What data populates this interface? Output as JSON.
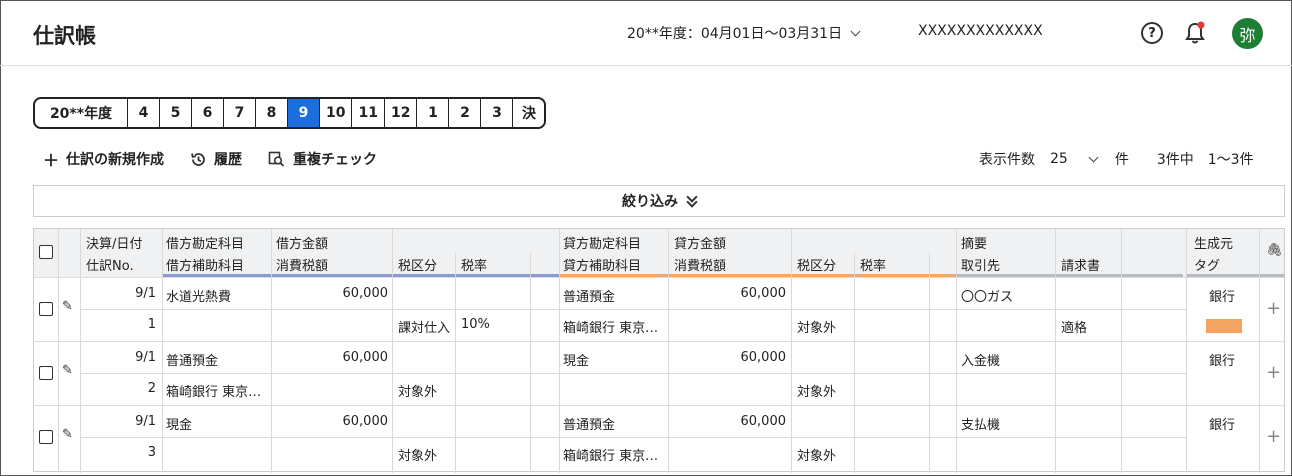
{
  "header": {
    "title": "仕訳帳",
    "period": "20**年度：04月01日～03月31日",
    "company": "XXXXXXXXXXXXX",
    "help_glyph": "?",
    "avatar": "弥"
  },
  "months": [
    "20**年度",
    "4",
    "5",
    "6",
    "7",
    "8",
    "9",
    "10",
    "11",
    "12",
    "1",
    "2",
    "3",
    "決"
  ],
  "active_month": "9",
  "toolbar": {
    "new_entry": "仕訳の新規作成",
    "history": "履歴",
    "duplicate_check": "重複チェック"
  },
  "pager": {
    "label": "表示件数",
    "per_page": "25",
    "unit": "件",
    "total": "3件中",
    "range": "1～3件"
  },
  "filter_label": "絞り込み",
  "table": {
    "headers": {
      "date": "決算/日付",
      "no": "仕訳No.",
      "debit_account": "借方勘定科目",
      "debit_sub": "借方補助科目",
      "debit_amount": "借方金額",
      "debit_tax_amount": "消費税額",
      "debit_tax_class": "税区分",
      "debit_tax_rate": "税率",
      "credit_account": "貸方勘定科目",
      "credit_sub": "貸方補助科目",
      "credit_amount": "貸方金額",
      "credit_tax_amount": "消費税額",
      "credit_tax_class": "税区分",
      "credit_tax_rate": "税率",
      "memo": "摘要",
      "partner": "取引先",
      "invoice": "請求書",
      "origin": "生成元",
      "tag": "タグ"
    },
    "rows": [
      {
        "date": "9/1",
        "no": "1",
        "debit_account": "水道光熱費",
        "debit_sub": "",
        "debit_amount": "60,000",
        "debit_tax_class": "課対仕入",
        "debit_tax_rate": "10%",
        "credit_account": "普通預金",
        "credit_sub": "箱崎銀行 東京…",
        "credit_amount": "60,000",
        "credit_tax_class": "対象外",
        "memo": "〇〇ガス",
        "invoice": "適格",
        "origin": "銀行",
        "tag_color": "#f4a460"
      },
      {
        "date": "9/1",
        "no": "2",
        "debit_account": "普通預金",
        "debit_sub": "箱崎銀行 東京…",
        "debit_amount": "60,000",
        "debit_tax_class": "対象外",
        "debit_tax_rate": "",
        "credit_account": "現金",
        "credit_sub": "",
        "credit_amount": "60,000",
        "credit_tax_class": "対象外",
        "memo": "入金機",
        "invoice": "",
        "origin": "銀行",
        "tag_color": ""
      },
      {
        "date": "9/1",
        "no": "3",
        "debit_account": "現金",
        "debit_sub": "",
        "debit_amount": "60,000",
        "debit_tax_class": "対象外",
        "debit_tax_rate": "",
        "credit_account": "普通預金",
        "credit_sub": "箱崎銀行 東京…",
        "credit_amount": "60,000",
        "credit_tax_class": "対象外",
        "memo": "支払機",
        "invoice": "",
        "origin": "銀行",
        "tag_color": ""
      }
    ]
  },
  "colors": {
    "accent": "#1a6fdc",
    "debit_underline": "#8a9ad6",
    "credit_underline": "#f0a868",
    "avatar_bg": "#1e7e34",
    "notification_dot": "#e53935"
  }
}
